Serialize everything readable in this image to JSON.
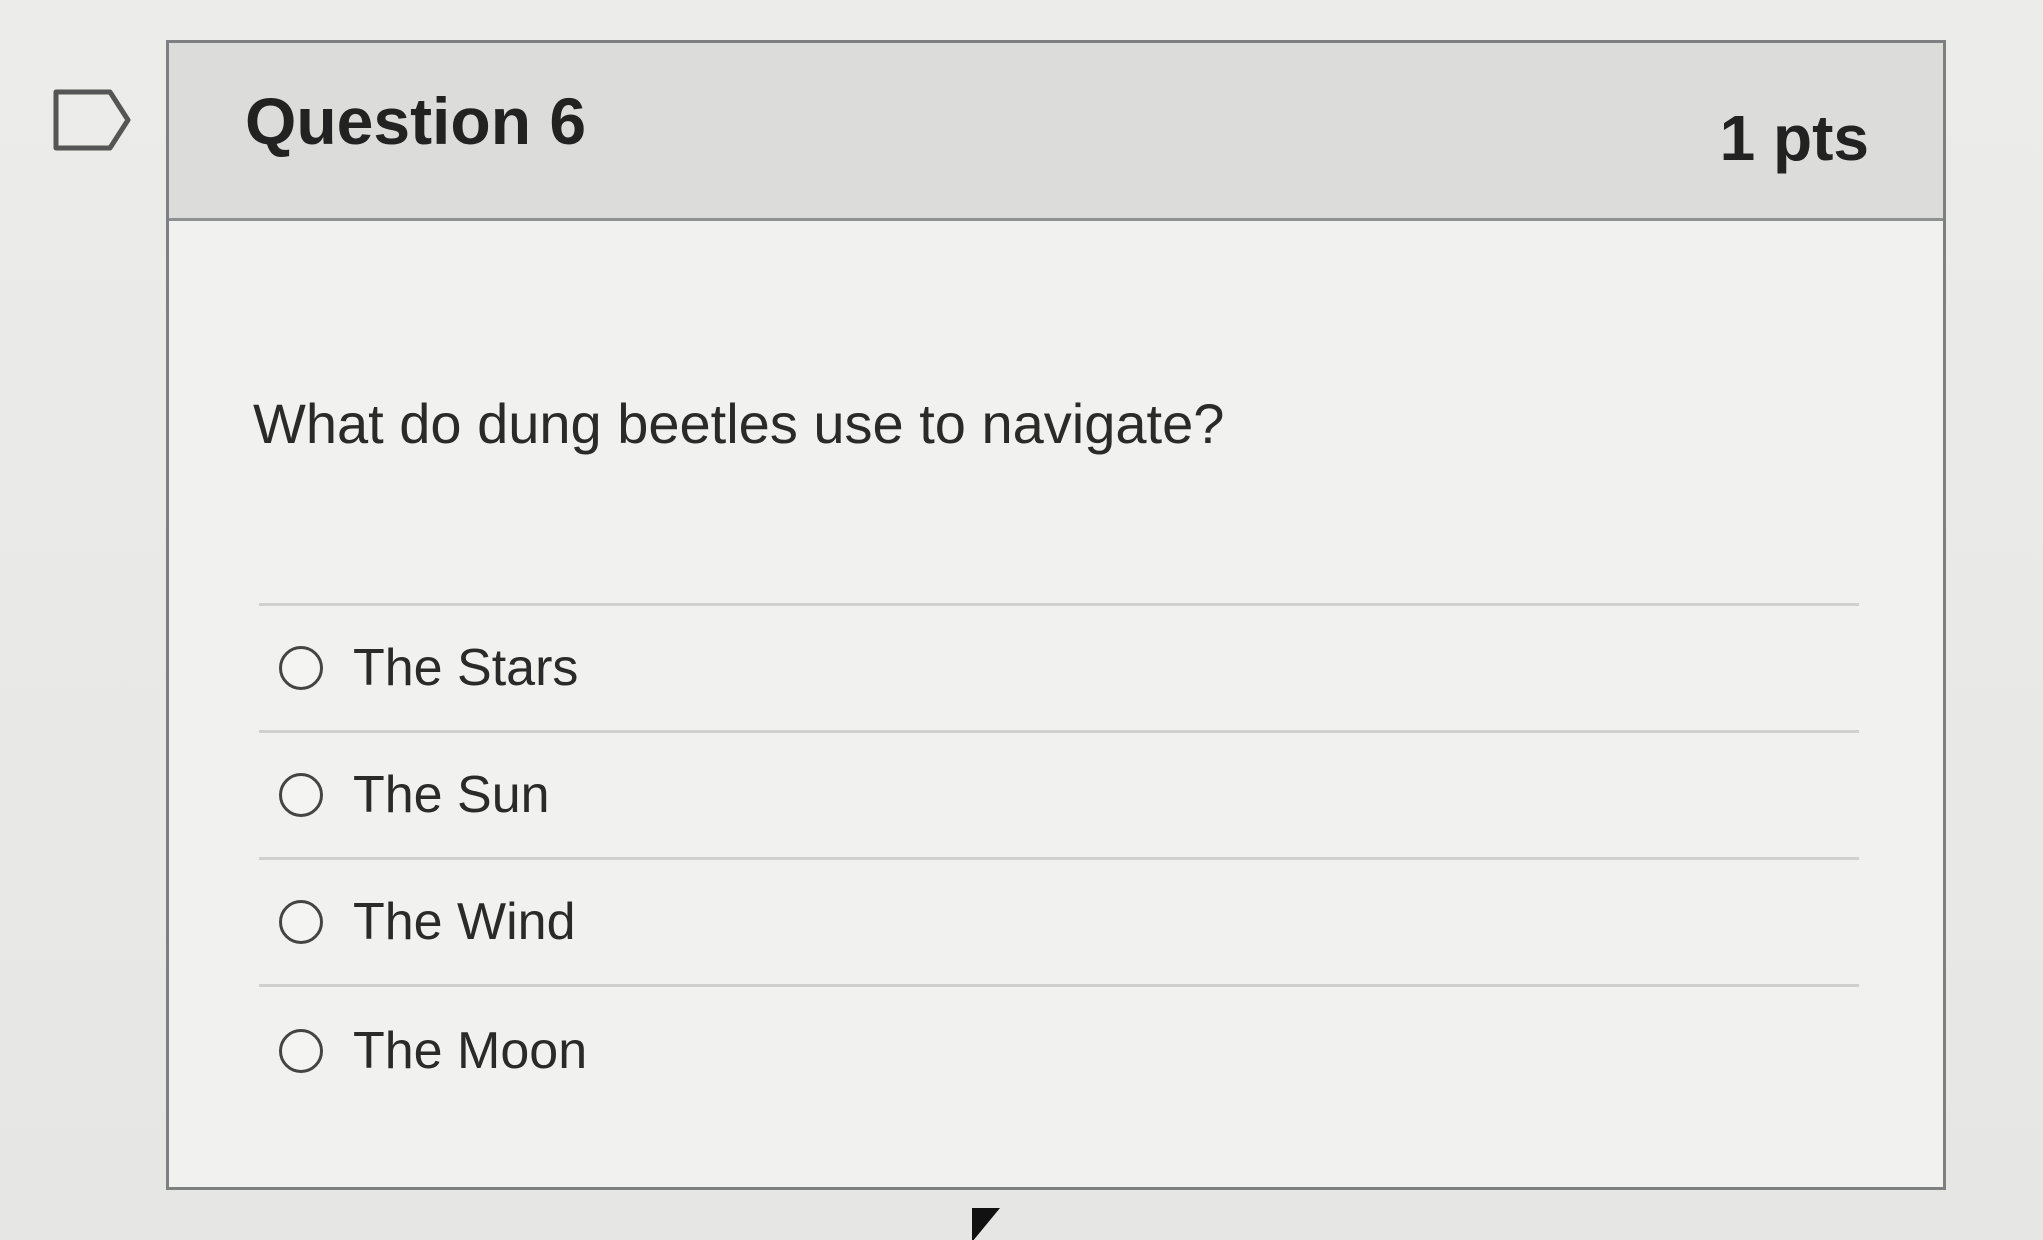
{
  "question": {
    "title": "Question 6",
    "points": "1 pts",
    "text": "What do dung beetles use to navigate?"
  },
  "answers": [
    {
      "label": "The Stars"
    },
    {
      "label": "The Sun"
    },
    {
      "label": "The Wind"
    },
    {
      "label": "The Moon"
    }
  ],
  "icons": {
    "flag": "flag-outline-icon",
    "cursor": "mouse-cursor-icon"
  }
}
